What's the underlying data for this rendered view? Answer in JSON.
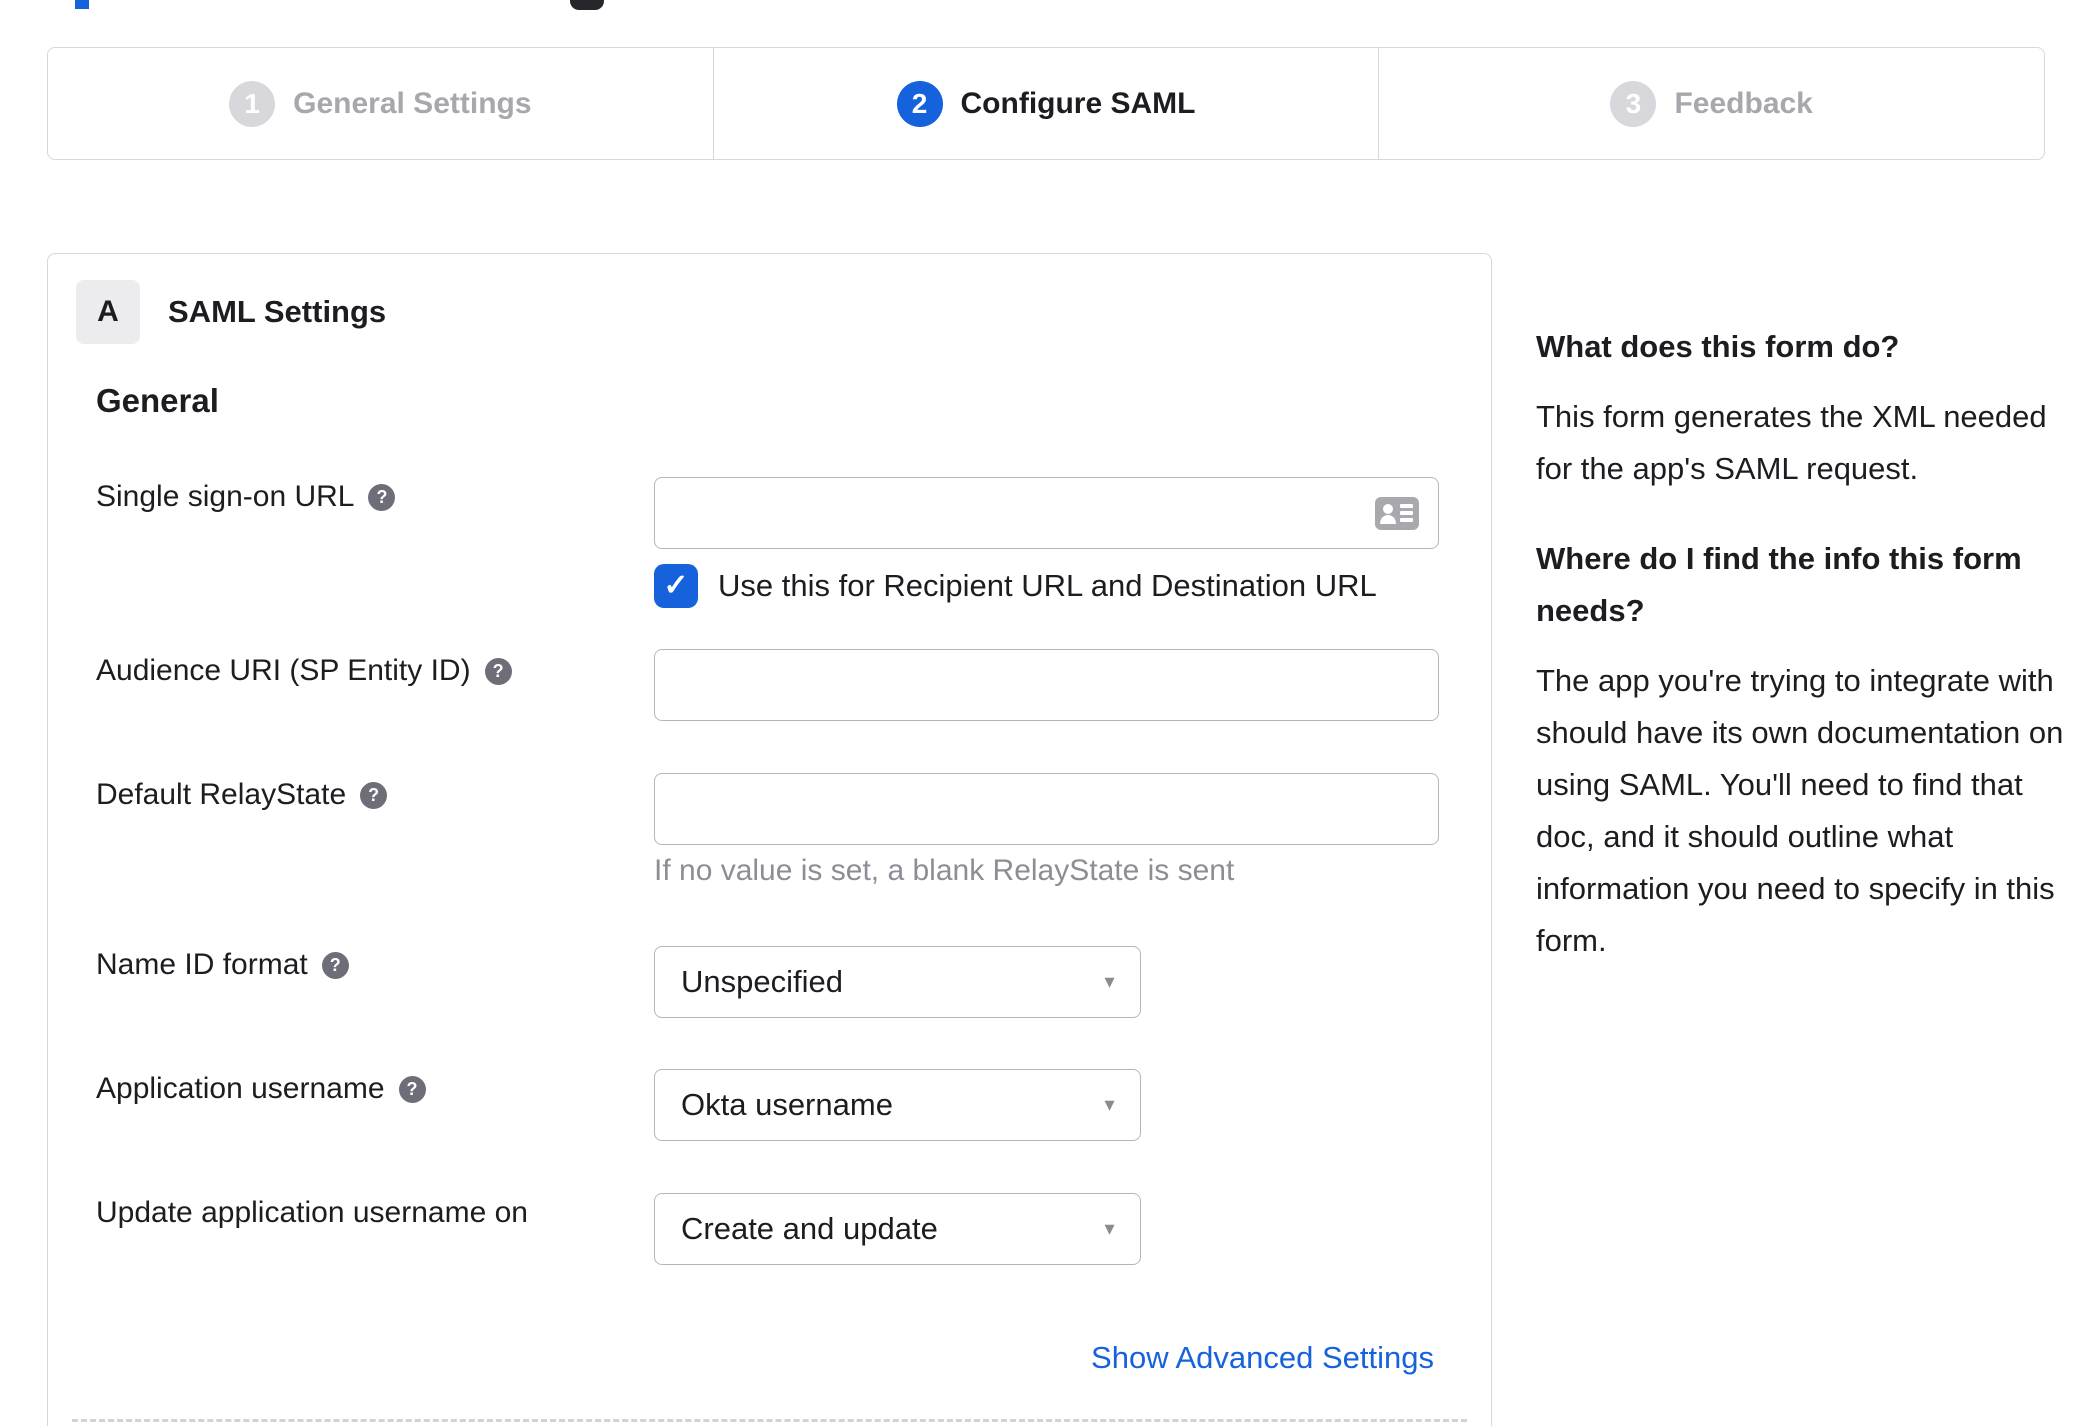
{
  "colors": {
    "accent_blue": "#1662dd",
    "inactive_step_gray": "#d7d7dc",
    "text_dark": "#1d1d21",
    "muted_gray": "#8d8d95",
    "border_gray": "#d7d7dc"
  },
  "icons": {
    "help_glyph": "?",
    "caret_glyph": "▼",
    "check_glyph": "✓",
    "contact_card": "contact-card-icon"
  },
  "stepper": {
    "steps": [
      {
        "number": "1",
        "label": "General Settings",
        "state": "inactive"
      },
      {
        "number": "2",
        "label": "Configure SAML",
        "state": "active"
      },
      {
        "number": "3",
        "label": "Feedback",
        "state": "inactive"
      }
    ]
  },
  "panel": {
    "badge": "A",
    "title": "SAML Settings",
    "section_heading": "General",
    "fields": {
      "sso": {
        "label": "Single sign-on URL",
        "value": "",
        "checkbox_checked": true,
        "checkbox_label": "Use this for Recipient URL and Destination URL"
      },
      "audience": {
        "label": "Audience URI (SP Entity ID)",
        "value": ""
      },
      "relay": {
        "label": "Default RelayState",
        "value": "",
        "hint": "If no value is set, a blank RelayState is sent"
      },
      "nameid": {
        "label": "Name ID format",
        "value": "Unspecified"
      },
      "appuser": {
        "label": "Application username",
        "value": "Okta username"
      },
      "update": {
        "label": "Update application username on",
        "value": "Create and update"
      }
    },
    "advanced_link": "Show Advanced Settings"
  },
  "sidebar": {
    "sections": [
      {
        "heading": "What does this form do?",
        "body": "This form generates the XML needed for the app's SAML request."
      },
      {
        "heading": "Where do I find the info this form needs?",
        "body": "The app you're trying to integrate with should have its own documentation on using SAML. You'll need to find that doc, and it should outline what information you need to specify in this form."
      }
    ]
  }
}
